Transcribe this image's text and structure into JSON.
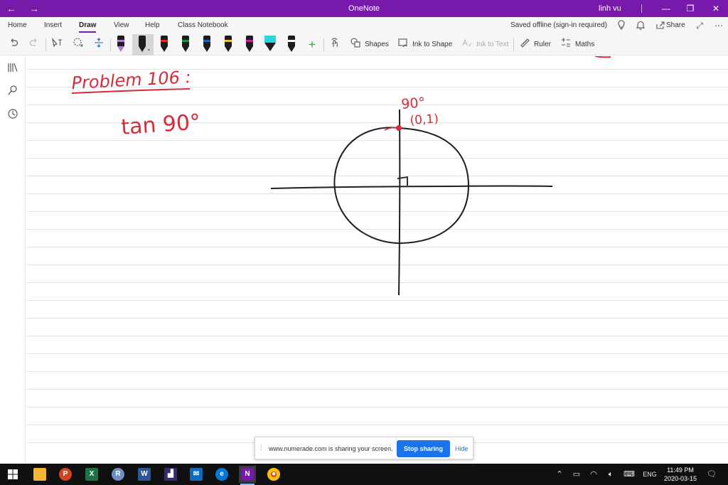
{
  "titlebar": {
    "title": "OneNote",
    "user": "linh vu",
    "back_icon": "arrow-left-icon",
    "forward_icon": "arrow-right-icon"
  },
  "menu": {
    "tabs": [
      "Home",
      "Insert",
      "Draw",
      "View",
      "Help",
      "Class Notebook"
    ],
    "active_tab": "Draw",
    "status": "Saved offline (sign-in required)",
    "share_label": "Share"
  },
  "toolbar": {
    "shapes_label": "Shapes",
    "ink_to_shape_label": "Ink to Shape",
    "ink_to_text_label": "Ink to Text",
    "ruler_label": "Ruler",
    "maths_label": "Maths",
    "pens": [
      {
        "color": "#b07ad8"
      },
      {
        "color": "#1d1d1d",
        "selected": true
      },
      {
        "color": "#e0282e"
      },
      {
        "color": "#1e8f3e"
      },
      {
        "color": "#1565c0"
      },
      {
        "color": "#f2c12e"
      },
      {
        "color": "#c61e9b"
      },
      {
        "color": "#2ed3e0",
        "highlighter": true
      },
      {
        "color": "#ffffff"
      }
    ]
  },
  "note": {
    "heading": "Problem 106 :",
    "expression": "tan 90°",
    "angle_label": "90°",
    "point_label": "(0,1)",
    "ink_color": "#d62c39"
  },
  "share_notice": {
    "message": "www.numerade.com is sharing your screen.",
    "stop_label": "Stop sharing",
    "hide_label": "Hide"
  },
  "taskbar": {
    "language": "ENG",
    "time": "11:49 PM",
    "date": "2020-03-15"
  }
}
